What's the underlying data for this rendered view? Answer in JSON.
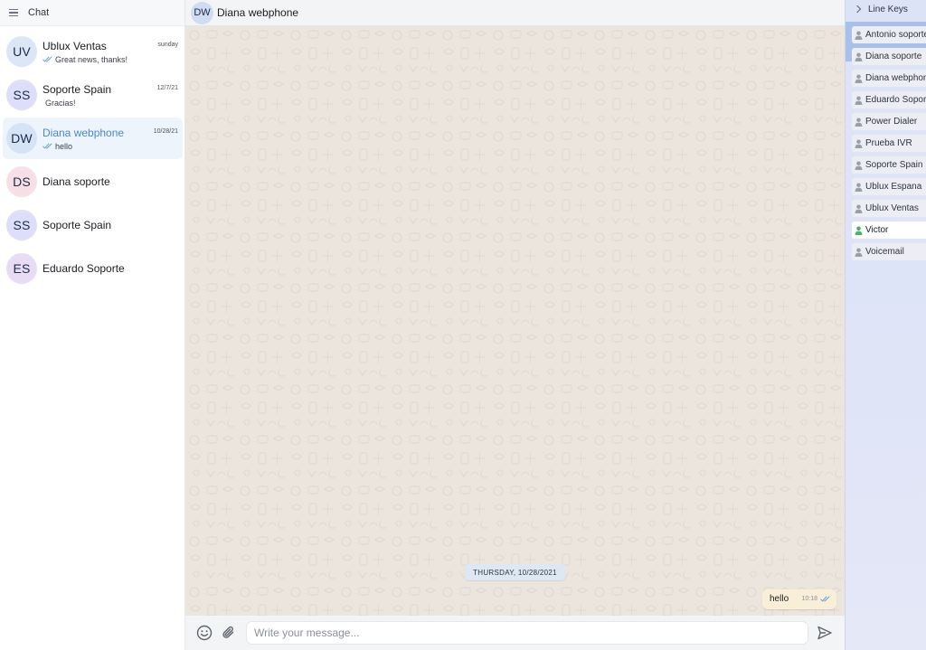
{
  "sidebar": {
    "title": "Chat",
    "chats": [
      {
        "initials": "UV",
        "name": "Ublux Ventas",
        "preview": "Great news, thanks!",
        "time": "sunday",
        "read_ticks": true,
        "avatar_color": "#dce6f7"
      },
      {
        "initials": "SS",
        "name": "Soporte Spain",
        "preview": "Gracias!",
        "time": "12/7/21",
        "read_ticks": false,
        "avatar_color": "#dcdff7"
      },
      {
        "initials": "DW",
        "name": "Diana webphone",
        "preview": "hello",
        "time": "10/28/21",
        "read_ticks": true,
        "active": true,
        "avatar_color": "#d5e3f5"
      },
      {
        "initials": "DS",
        "name": "Diana soporte",
        "preview": "",
        "time": "",
        "read_ticks": false,
        "avatar_color": "#f7dfe6"
      },
      {
        "initials": "SS",
        "name": "Soporte Spain",
        "preview": "",
        "time": "",
        "read_ticks": false,
        "avatar_color": "#dcdff7"
      },
      {
        "initials": "ES",
        "name": "Eduardo Soporte",
        "preview": "",
        "time": "",
        "read_ticks": false,
        "avatar_color": "#e8dcf5"
      }
    ]
  },
  "conversation": {
    "header_initials": "DW",
    "header_name": "Diana webphone",
    "date_separator": "THURSDAY, 10/28/2021",
    "messages": [
      {
        "text": "hello",
        "time": "10:18",
        "outgoing": true,
        "read": true
      }
    ],
    "composer_placeholder": "Write your message..."
  },
  "line_keys": {
    "title": "Line Keys",
    "items": [
      {
        "label": "Antonio soporte",
        "online": false
      },
      {
        "label": "Diana soporte",
        "online": false
      },
      {
        "label": "Diana webphone",
        "online": false
      },
      {
        "label": "Eduardo Soporte",
        "online": false
      },
      {
        "label": "Power Dialer",
        "online": false
      },
      {
        "label": "Prueba IVR",
        "online": false
      },
      {
        "label": "Soporte Spain",
        "online": false
      },
      {
        "label": "Ublux Espana",
        "online": false
      },
      {
        "label": "Ublux Ventas",
        "online": false
      },
      {
        "label": "Victor",
        "online": true
      },
      {
        "label": "Voicemail",
        "online": false
      }
    ]
  },
  "colors": {
    "accent": "#4a86d1",
    "tick_blue": "#5b9bd5",
    "online_green": "#4caf6e",
    "offline_gray": "#9aa0a8",
    "chat_background": "#ebe5de",
    "outgoing_bubble": "#f9efd9"
  }
}
